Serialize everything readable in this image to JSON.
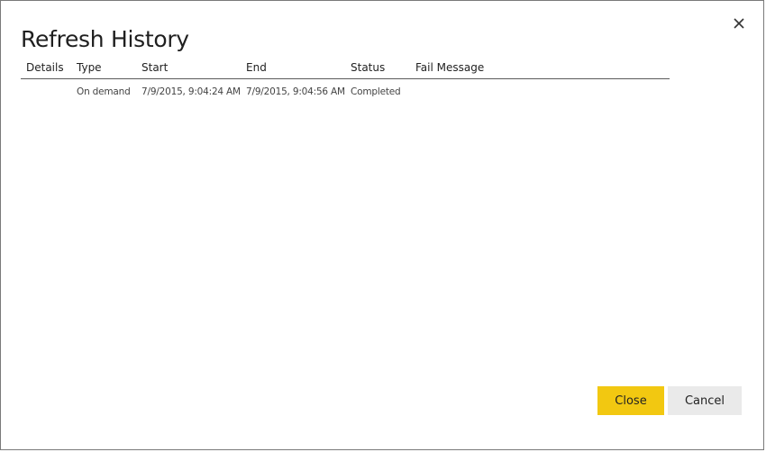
{
  "dialog": {
    "title": "Refresh History",
    "close_icon": "close-icon"
  },
  "table": {
    "columns": [
      "Details",
      "Type",
      "Start",
      "End",
      "Status",
      "Fail Message"
    ],
    "rows": [
      {
        "details": "",
        "type": "On demand",
        "start": "7/9/2015, 9:04:24 AM",
        "end": "7/9/2015, 9:04:56 AM",
        "status": "Completed",
        "fail_message": ""
      }
    ]
  },
  "buttons": {
    "close_label": "Close",
    "cancel_label": "Cancel"
  },
  "colors": {
    "primary_button": "#f2c811",
    "secondary_button": "#eaeaea",
    "header_rule": "#5a5a5a"
  }
}
